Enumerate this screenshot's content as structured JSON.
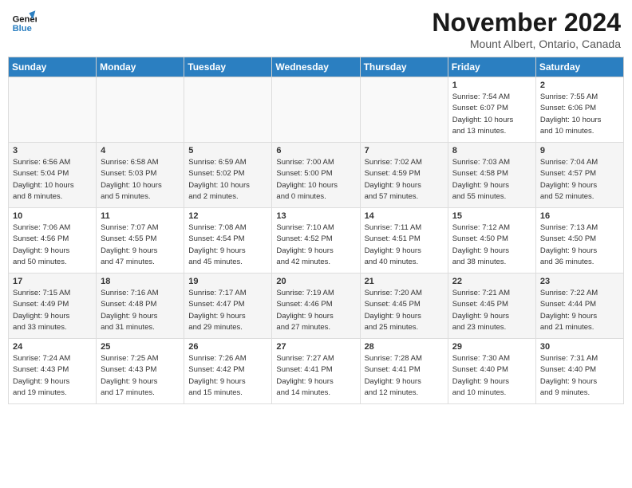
{
  "header": {
    "logo_line1": "General",
    "logo_line2": "Blue",
    "month": "November 2024",
    "location": "Mount Albert, Ontario, Canada"
  },
  "weekdays": [
    "Sunday",
    "Monday",
    "Tuesday",
    "Wednesday",
    "Thursday",
    "Friday",
    "Saturday"
  ],
  "weeks": [
    [
      {
        "day": "",
        "info": ""
      },
      {
        "day": "",
        "info": ""
      },
      {
        "day": "",
        "info": ""
      },
      {
        "day": "",
        "info": ""
      },
      {
        "day": "",
        "info": ""
      },
      {
        "day": "1",
        "info": "Sunrise: 7:54 AM\nSunset: 6:07 PM\nDaylight: 10 hours\nand 13 minutes."
      },
      {
        "day": "2",
        "info": "Sunrise: 7:55 AM\nSunset: 6:06 PM\nDaylight: 10 hours\nand 10 minutes."
      }
    ],
    [
      {
        "day": "3",
        "info": "Sunrise: 6:56 AM\nSunset: 5:04 PM\nDaylight: 10 hours\nand 8 minutes."
      },
      {
        "day": "4",
        "info": "Sunrise: 6:58 AM\nSunset: 5:03 PM\nDaylight: 10 hours\nand 5 minutes."
      },
      {
        "day": "5",
        "info": "Sunrise: 6:59 AM\nSunset: 5:02 PM\nDaylight: 10 hours\nand 2 minutes."
      },
      {
        "day": "6",
        "info": "Sunrise: 7:00 AM\nSunset: 5:00 PM\nDaylight: 10 hours\nand 0 minutes."
      },
      {
        "day": "7",
        "info": "Sunrise: 7:02 AM\nSunset: 4:59 PM\nDaylight: 9 hours\nand 57 minutes."
      },
      {
        "day": "8",
        "info": "Sunrise: 7:03 AM\nSunset: 4:58 PM\nDaylight: 9 hours\nand 55 minutes."
      },
      {
        "day": "9",
        "info": "Sunrise: 7:04 AM\nSunset: 4:57 PM\nDaylight: 9 hours\nand 52 minutes."
      }
    ],
    [
      {
        "day": "10",
        "info": "Sunrise: 7:06 AM\nSunset: 4:56 PM\nDaylight: 9 hours\nand 50 minutes."
      },
      {
        "day": "11",
        "info": "Sunrise: 7:07 AM\nSunset: 4:55 PM\nDaylight: 9 hours\nand 47 minutes."
      },
      {
        "day": "12",
        "info": "Sunrise: 7:08 AM\nSunset: 4:54 PM\nDaylight: 9 hours\nand 45 minutes."
      },
      {
        "day": "13",
        "info": "Sunrise: 7:10 AM\nSunset: 4:52 PM\nDaylight: 9 hours\nand 42 minutes."
      },
      {
        "day": "14",
        "info": "Sunrise: 7:11 AM\nSunset: 4:51 PM\nDaylight: 9 hours\nand 40 minutes."
      },
      {
        "day": "15",
        "info": "Sunrise: 7:12 AM\nSunset: 4:50 PM\nDaylight: 9 hours\nand 38 minutes."
      },
      {
        "day": "16",
        "info": "Sunrise: 7:13 AM\nSunset: 4:50 PM\nDaylight: 9 hours\nand 36 minutes."
      }
    ],
    [
      {
        "day": "17",
        "info": "Sunrise: 7:15 AM\nSunset: 4:49 PM\nDaylight: 9 hours\nand 33 minutes."
      },
      {
        "day": "18",
        "info": "Sunrise: 7:16 AM\nSunset: 4:48 PM\nDaylight: 9 hours\nand 31 minutes."
      },
      {
        "day": "19",
        "info": "Sunrise: 7:17 AM\nSunset: 4:47 PM\nDaylight: 9 hours\nand 29 minutes."
      },
      {
        "day": "20",
        "info": "Sunrise: 7:19 AM\nSunset: 4:46 PM\nDaylight: 9 hours\nand 27 minutes."
      },
      {
        "day": "21",
        "info": "Sunrise: 7:20 AM\nSunset: 4:45 PM\nDaylight: 9 hours\nand 25 minutes."
      },
      {
        "day": "22",
        "info": "Sunrise: 7:21 AM\nSunset: 4:45 PM\nDaylight: 9 hours\nand 23 minutes."
      },
      {
        "day": "23",
        "info": "Sunrise: 7:22 AM\nSunset: 4:44 PM\nDaylight: 9 hours\nand 21 minutes."
      }
    ],
    [
      {
        "day": "24",
        "info": "Sunrise: 7:24 AM\nSunset: 4:43 PM\nDaylight: 9 hours\nand 19 minutes."
      },
      {
        "day": "25",
        "info": "Sunrise: 7:25 AM\nSunset: 4:43 PM\nDaylight: 9 hours\nand 17 minutes."
      },
      {
        "day": "26",
        "info": "Sunrise: 7:26 AM\nSunset: 4:42 PM\nDaylight: 9 hours\nand 15 minutes."
      },
      {
        "day": "27",
        "info": "Sunrise: 7:27 AM\nSunset: 4:41 PM\nDaylight: 9 hours\nand 14 minutes."
      },
      {
        "day": "28",
        "info": "Sunrise: 7:28 AM\nSunset: 4:41 PM\nDaylight: 9 hours\nand 12 minutes."
      },
      {
        "day": "29",
        "info": "Sunrise: 7:30 AM\nSunset: 4:40 PM\nDaylight: 9 hours\nand 10 minutes."
      },
      {
        "day": "30",
        "info": "Sunrise: 7:31 AM\nSunset: 4:40 PM\nDaylight: 9 hours\nand 9 minutes."
      }
    ]
  ]
}
